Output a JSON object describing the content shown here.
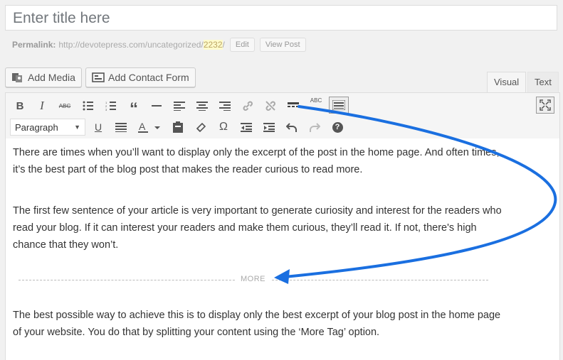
{
  "title": {
    "placeholder": "Enter title here"
  },
  "permalink": {
    "label": "Permalink:",
    "url_base": "http://devotepress.com/uncategorized/",
    "slug": "2232",
    "trail": "/",
    "edit_label": "Edit",
    "view_label": "View Post"
  },
  "media_buttons": {
    "add_media": "Add Media",
    "add_contact_form": "Add Contact Form"
  },
  "tabs": {
    "visual": "Visual",
    "text": "Text"
  },
  "toolbar": {
    "format_select": "Paragraph",
    "row1_icons": [
      "bold-icon",
      "italic-icon",
      "strikethrough-icon",
      "bullet-list-icon",
      "numbered-list-icon",
      "blockquote-icon",
      "horizontal-rule-icon",
      "align-left-icon",
      "align-center-icon",
      "align-right-icon",
      "link-icon",
      "unlink-icon",
      "read-more-icon",
      "spellcheck-icon",
      "toolbar-toggle-icon",
      "fullscreen-icon"
    ],
    "row2_icons": [
      "underline-icon",
      "justify-icon",
      "text-color-icon",
      "paste-text-icon",
      "clear-formatting-icon",
      "special-character-icon",
      "outdent-icon",
      "indent-icon",
      "undo-icon",
      "redo-icon",
      "help-icon"
    ],
    "glyphs": {
      "bold": "B",
      "italic": "I",
      "strike": "ABC",
      "spell": "ABC",
      "quote": "“",
      "omega": "Ω",
      "help": "?"
    }
  },
  "content": {
    "p1": "There are times when you’ll want to display only the excerpt of the post in the home page. And often times, it’s the best part of the blog post that makes the reader curious to read more.",
    "p2": "The first few sentence of your article is very important to generate curiosity and interest for the readers who read your blog. If it can interest your readers and make them curious, they’ll read it. If not, there's high chance that they won’t.",
    "more_label": "MORE",
    "p3": "The best possible way to achieve this is to display only the best excerpt of your blog post in the home page of your website. You do that by splitting your content using the ‘More Tag’ option."
  },
  "annotation": {
    "arrow_color": "#1a6fe0"
  }
}
